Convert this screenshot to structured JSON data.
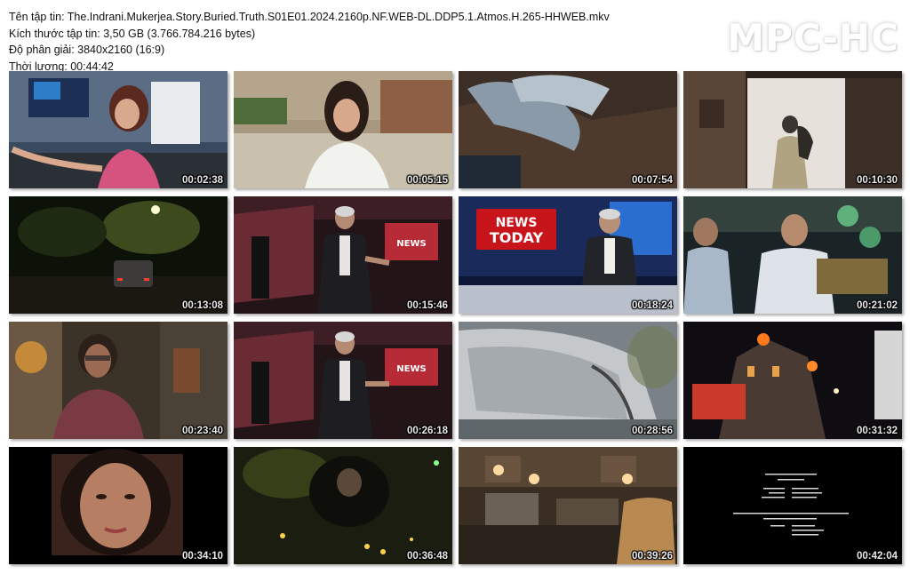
{
  "info": {
    "filename": "Tên tập tin: The.Indrani.Mukerjea.Story.Buried.Truth.S01E01.2024.2160p.NF.WEB-DL.DDP5.1.Atmos.H.265-HHWEB.mkv",
    "filesize": "Kích thước tập tin: 3,50 GB (3.766.784.216 bytes)",
    "resolution": "Độ phân giải: 3840x2160 (16:9)",
    "duration": "Thời lượng: 00:44:42"
  },
  "logo": "MPC-HC",
  "thumbnails": [
    {
      "time": "00:02:38",
      "scene": "woman-pink-top-office"
    },
    {
      "time": "00:05:15",
      "scene": "woman-outdoor-street"
    },
    {
      "time": "00:07:54",
      "scene": "digging-ground"
    },
    {
      "time": "00:10:30",
      "scene": "silhouette-doorway"
    },
    {
      "time": "00:13:08",
      "scene": "night-street-car"
    },
    {
      "time": "00:15:46",
      "scene": "news-studio-wide"
    },
    {
      "time": "00:18:24",
      "scene": "news-today-anchor"
    },
    {
      "time": "00:21:02",
      "scene": "car-interior-men"
    },
    {
      "time": "00:23:40",
      "scene": "woman-glasses-interview"
    },
    {
      "time": "00:26:18",
      "scene": "news-studio-wide-2"
    },
    {
      "time": "00:28:56",
      "scene": "blurred-car"
    },
    {
      "time": "00:31:32",
      "scene": "night-fire-building"
    },
    {
      "time": "00:34:10",
      "scene": "woman-closeup"
    },
    {
      "time": "00:36:48",
      "scene": "dark-car-lights"
    },
    {
      "time": "00:39:26",
      "scene": "hotel-lobby"
    },
    {
      "time": "00:42:04",
      "scene": "end-credits"
    }
  ],
  "colors": {
    "background": "#ffffff",
    "timestamp": "#e8e8e8",
    "news_red": "#c8151b"
  }
}
